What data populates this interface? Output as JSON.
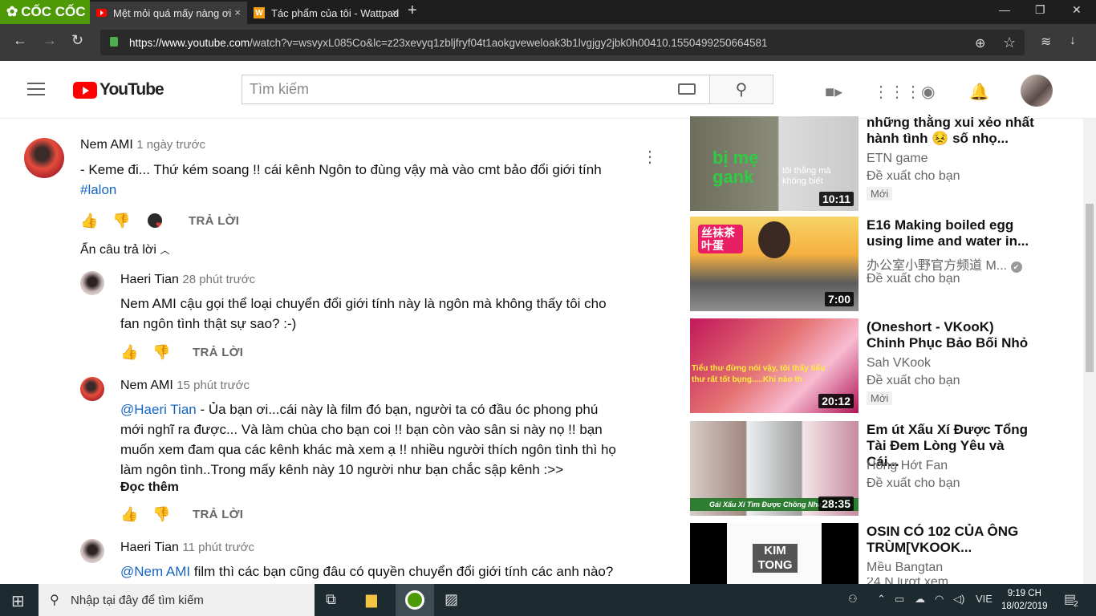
{
  "browser": {
    "brand": "CỐC CỐC",
    "tabs": [
      {
        "label": "Mệt mỏi quá mấy nàng ơi",
        "close": "×"
      },
      {
        "label": "Tác phẩm của tôi - Wattpad",
        "close": "×"
      }
    ],
    "new_tab": "+",
    "url_host": "https://www.youtube.com",
    "url_path": "/watch?v=wsvyxL085Co&lc=z23xevyq1zbljfryf04t1aokgveweloak3b1lvgjgy2jbk0h00410.1550499250664581",
    "win_min": "—",
    "win_max": "❐",
    "win_close": "✕",
    "back": "←",
    "forward": "→",
    "reload": "↻",
    "zoom": "⊕",
    "star": "☆",
    "download": "↓"
  },
  "youtube": {
    "logo_text": "YouTube",
    "search_placeholder": "Tìm kiếm",
    "search_icon": "⚲"
  },
  "comments": {
    "main": {
      "author": "Nem AMI",
      "time": "1 ngày trước",
      "text": "- Keme đi... Thứ kém soang !! cái kênh Ngôn to đùng vậy mà vào cmt bảo đổi giới tính",
      "hashtag": "#lalon",
      "reply_label": "TRẢ LỜI",
      "more": "⋮"
    },
    "toggle_label": "Ẩn câu trả lời",
    "replies": [
      {
        "author": "Haeri Tian",
        "time": "28 phút trước",
        "lines": [
          "Nem AMI cậu gọi thể loại chuyển đổi giới tính này là ngôn mà không thấy tôi cho",
          "fan ngôn tình thật sự sao? :-)"
        ],
        "reply_label": "TRẢ LỜI"
      },
      {
        "author": "Nem AMI",
        "time": "15 phút trước",
        "mention": "@Haeri Tian",
        "lines": [
          " - Ủa bạn ơi...cái này là film đó bạn, người ta có đầu óc phong phú",
          "mới nghĩ ra được... Và làm chùa cho bạn coi !! bạn còn vào sân si này nọ !! bạn",
          "muốn xem đam qua các kênh khác mà xem ạ !! nhiều người thích ngôn tình thì họ",
          "làm ngôn tình..Trong mấy kênh này 10 người như bạn chắc sập kênh :>>"
        ],
        "read_more": "Đọc thêm",
        "reply_label": "TRẢ LỜI"
      },
      {
        "author": "Haeri Tian",
        "time": "11 phút trước",
        "mention": "@Nem AMI",
        "lines": [
          " film thì các bạn cũng đâu có quyền chuyển đổi giới tính các anh nào?"
        ]
      }
    ]
  },
  "suggestions": [
    {
      "title": "những thằng xui xẻo nhất hành tình 😣 số nhọ...",
      "channel": "ETN game",
      "rec": "Đề xuất cho bạn",
      "badge": "Mới",
      "duration": "10:11",
      "thumb_text1": "bị mẹ gank",
      "thumb_text2": "tôi thằng mà không biết"
    },
    {
      "title": "E16 Making boiled egg using lime and water in...",
      "channel": "办公室小野官方频道 M...",
      "verified": "✔",
      "rec": "Đề xuất cho bạn",
      "duration": "7:00",
      "thumb_text1": "丝袜茶叶蛋"
    },
    {
      "title": "(Oneshort - VKooK) Chinh Phục Bảo Bối Nhỏ",
      "channel": "Sah VKook",
      "rec": "Đề xuất cho bạn",
      "badge": "Mới",
      "duration": "20:12",
      "thumb_text1": "Tiểu thư đừng nói vậy, tôi thấy tiểu thư rất tốt bụng.....Khi nào th"
    },
    {
      "title": "Em út Xấu Xí Được Tổng Tài Đem Lòng Yêu và Cái...",
      "channel": "Hóng Hớt Fan",
      "rec": "Đề xuất cho bạn",
      "duration": "28:35",
      "thumb_text1": "Gái Xấu Xí Tìm Được Chồng Nha"
    },
    {
      "title": "OSIN CÓ 102 CỦA ÔNG TRÙM[VKOOK...",
      "channel": "Mều Bangtan",
      "rec": "24 N lượt xem",
      "thumb_text1": "KIM TONG"
    }
  ],
  "taskbar": {
    "search_placeholder": "Nhập tại đây để tìm kiếm",
    "lang": "VIE",
    "time": "9:19 CH",
    "date": "18/02/2019",
    "notif_count": "2"
  }
}
